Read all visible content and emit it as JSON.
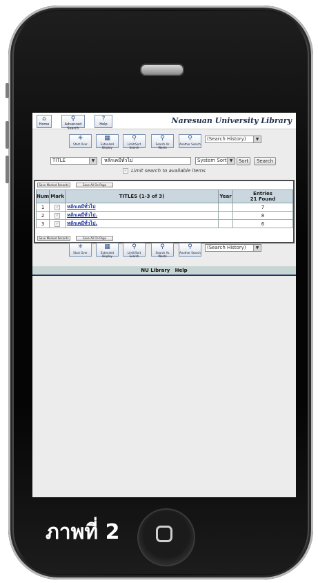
{
  "header": {
    "home_label": "Home",
    "advanced_label": "Advanced Search",
    "help_label": "Help",
    "brand": "Naresuan University Library"
  },
  "toolbar": {
    "start_over": "Start Over",
    "extended_display": "Extended Display",
    "limit_sort": "Limit/Sort Search",
    "search_as_words": "Search As Words",
    "another_search": "Another Search",
    "search_history": "(Search History)"
  },
  "search": {
    "field": "TITLE",
    "query": "หลักเคมีทั่วไป",
    "sort": "System Sorted",
    "sort_button": "Sort",
    "search_button": "Search",
    "limit_text": "Limit search to available items"
  },
  "results": {
    "save_marked": "Save Marked Records",
    "save_all": "Save All On Page",
    "headers": {
      "num": "Num",
      "mark": "Mark",
      "titles": "TITLES (1-3 of 3)",
      "year": "Year",
      "entries": "Entries",
      "found": "21 Found"
    },
    "rows": [
      {
        "num": "1",
        "title": "หลักเคมีทั่วไป",
        "year": "",
        "entries": "7"
      },
      {
        "num": "2",
        "title": "หลักเคมีทั่วไป.",
        "year": "",
        "entries": "8"
      },
      {
        "num": "3",
        "title": "หลักเคมีทั่วไป.",
        "year": "",
        "entries": "6"
      }
    ]
  },
  "footer": {
    "nu_library": "NU Library",
    "help": "Help"
  },
  "caption": "ภาพที่ 2"
}
